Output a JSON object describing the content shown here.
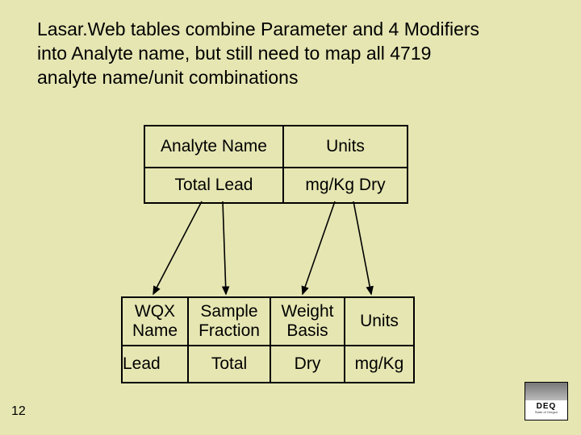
{
  "title": "Lasar.Web tables combine Parameter and 4 Modifiers into Analyte name, but still need to map all 4719 analyte name/unit combinations",
  "top_table": {
    "headers": [
      "Analyte Name",
      "Units"
    ],
    "row": [
      "Total Lead",
      "mg/Kg Dry"
    ]
  },
  "bottom_table": {
    "headers": [
      "WQX Name",
      "Sample Fraction",
      "Weight Basis",
      "Units"
    ],
    "row": [
      "Lead",
      "Total",
      "Dry",
      "mg/Kg"
    ]
  },
  "page_number": "12",
  "logo": {
    "label": "DEQ",
    "sub": "State of Oregon"
  },
  "chart_data": {
    "type": "table",
    "mappings": [
      {
        "from_col": "Analyte Name",
        "from_val": "Total Lead",
        "to_col": "WQX Name",
        "to_val": "Lead"
      },
      {
        "from_col": "Analyte Name",
        "from_val": "Total Lead",
        "to_col": "Sample Fraction",
        "to_val": "Total"
      },
      {
        "from_col": "Units",
        "from_val": "mg/Kg Dry",
        "to_col": "Weight Basis",
        "to_val": "Dry"
      },
      {
        "from_col": "Units",
        "from_val": "mg/Kg Dry",
        "to_col": "Units",
        "to_val": "mg/Kg"
      }
    ]
  }
}
